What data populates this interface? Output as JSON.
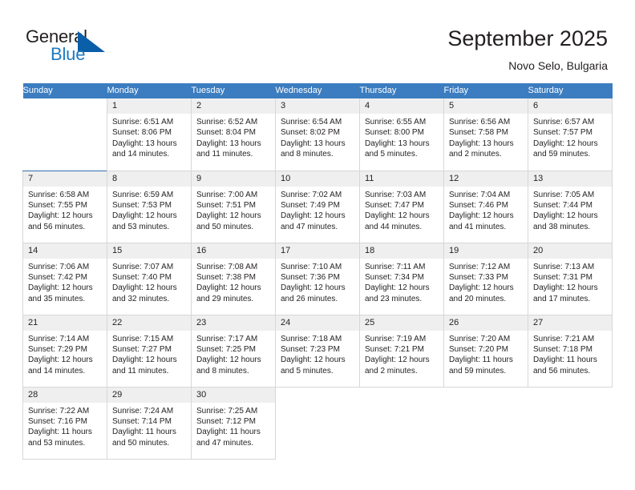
{
  "brand": {
    "word1": "General",
    "word2": "Blue",
    "icon": "triangle-logo",
    "color_dark": "#231f20",
    "color_blue": "#1f7ac0"
  },
  "header": {
    "title": "September 2025",
    "location": "Novo Selo, Bulgaria"
  },
  "theme": {
    "header_blue": "#3b7dc0",
    "week_divider": "#2f6fad",
    "cell_header_gray": "#efefef",
    "cell_border": "#d7d7d7"
  },
  "weekdays": [
    "Sunday",
    "Monday",
    "Tuesday",
    "Wednesday",
    "Thursday",
    "Friday",
    "Saturday"
  ],
  "weeks": [
    [
      {
        "empty": true
      },
      {
        "day": "1",
        "sunrise": "Sunrise: 6:51 AM",
        "sunset": "Sunset: 8:06 PM",
        "daylight1": "Daylight: 13 hours",
        "daylight2": "and 14 minutes."
      },
      {
        "day": "2",
        "sunrise": "Sunrise: 6:52 AM",
        "sunset": "Sunset: 8:04 PM",
        "daylight1": "Daylight: 13 hours",
        "daylight2": "and 11 minutes."
      },
      {
        "day": "3",
        "sunrise": "Sunrise: 6:54 AM",
        "sunset": "Sunset: 8:02 PM",
        "daylight1": "Daylight: 13 hours",
        "daylight2": "and 8 minutes."
      },
      {
        "day": "4",
        "sunrise": "Sunrise: 6:55 AM",
        "sunset": "Sunset: 8:00 PM",
        "daylight1": "Daylight: 13 hours",
        "daylight2": "and 5 minutes."
      },
      {
        "day": "5",
        "sunrise": "Sunrise: 6:56 AM",
        "sunset": "Sunset: 7:58 PM",
        "daylight1": "Daylight: 13 hours",
        "daylight2": "and 2 minutes."
      },
      {
        "day": "6",
        "sunrise": "Sunrise: 6:57 AM",
        "sunset": "Sunset: 7:57 PM",
        "daylight1": "Daylight: 12 hours",
        "daylight2": "and 59 minutes."
      }
    ],
    [
      {
        "day": "7",
        "sunrise": "Sunrise: 6:58 AM",
        "sunset": "Sunset: 7:55 PM",
        "daylight1": "Daylight: 12 hours",
        "daylight2": "and 56 minutes."
      },
      {
        "day": "8",
        "sunrise": "Sunrise: 6:59 AM",
        "sunset": "Sunset: 7:53 PM",
        "daylight1": "Daylight: 12 hours",
        "daylight2": "and 53 minutes."
      },
      {
        "day": "9",
        "sunrise": "Sunrise: 7:00 AM",
        "sunset": "Sunset: 7:51 PM",
        "daylight1": "Daylight: 12 hours",
        "daylight2": "and 50 minutes."
      },
      {
        "day": "10",
        "sunrise": "Sunrise: 7:02 AM",
        "sunset": "Sunset: 7:49 PM",
        "daylight1": "Daylight: 12 hours",
        "daylight2": "and 47 minutes."
      },
      {
        "day": "11",
        "sunrise": "Sunrise: 7:03 AM",
        "sunset": "Sunset: 7:47 PM",
        "daylight1": "Daylight: 12 hours",
        "daylight2": "and 44 minutes."
      },
      {
        "day": "12",
        "sunrise": "Sunrise: 7:04 AM",
        "sunset": "Sunset: 7:46 PM",
        "daylight1": "Daylight: 12 hours",
        "daylight2": "and 41 minutes."
      },
      {
        "day": "13",
        "sunrise": "Sunrise: 7:05 AM",
        "sunset": "Sunset: 7:44 PM",
        "daylight1": "Daylight: 12 hours",
        "daylight2": "and 38 minutes."
      }
    ],
    [
      {
        "day": "14",
        "sunrise": "Sunrise: 7:06 AM",
        "sunset": "Sunset: 7:42 PM",
        "daylight1": "Daylight: 12 hours",
        "daylight2": "and 35 minutes."
      },
      {
        "day": "15",
        "sunrise": "Sunrise: 7:07 AM",
        "sunset": "Sunset: 7:40 PM",
        "daylight1": "Daylight: 12 hours",
        "daylight2": "and 32 minutes."
      },
      {
        "day": "16",
        "sunrise": "Sunrise: 7:08 AM",
        "sunset": "Sunset: 7:38 PM",
        "daylight1": "Daylight: 12 hours",
        "daylight2": "and 29 minutes."
      },
      {
        "day": "17",
        "sunrise": "Sunrise: 7:10 AM",
        "sunset": "Sunset: 7:36 PM",
        "daylight1": "Daylight: 12 hours",
        "daylight2": "and 26 minutes."
      },
      {
        "day": "18",
        "sunrise": "Sunrise: 7:11 AM",
        "sunset": "Sunset: 7:34 PM",
        "daylight1": "Daylight: 12 hours",
        "daylight2": "and 23 minutes."
      },
      {
        "day": "19",
        "sunrise": "Sunrise: 7:12 AM",
        "sunset": "Sunset: 7:33 PM",
        "daylight1": "Daylight: 12 hours",
        "daylight2": "and 20 minutes."
      },
      {
        "day": "20",
        "sunrise": "Sunrise: 7:13 AM",
        "sunset": "Sunset: 7:31 PM",
        "daylight1": "Daylight: 12 hours",
        "daylight2": "and 17 minutes."
      }
    ],
    [
      {
        "day": "21",
        "sunrise": "Sunrise: 7:14 AM",
        "sunset": "Sunset: 7:29 PM",
        "daylight1": "Daylight: 12 hours",
        "daylight2": "and 14 minutes."
      },
      {
        "day": "22",
        "sunrise": "Sunrise: 7:15 AM",
        "sunset": "Sunset: 7:27 PM",
        "daylight1": "Daylight: 12 hours",
        "daylight2": "and 11 minutes."
      },
      {
        "day": "23",
        "sunrise": "Sunrise: 7:17 AM",
        "sunset": "Sunset: 7:25 PM",
        "daylight1": "Daylight: 12 hours",
        "daylight2": "and 8 minutes."
      },
      {
        "day": "24",
        "sunrise": "Sunrise: 7:18 AM",
        "sunset": "Sunset: 7:23 PM",
        "daylight1": "Daylight: 12 hours",
        "daylight2": "and 5 minutes."
      },
      {
        "day": "25",
        "sunrise": "Sunrise: 7:19 AM",
        "sunset": "Sunset: 7:21 PM",
        "daylight1": "Daylight: 12 hours",
        "daylight2": "and 2 minutes."
      },
      {
        "day": "26",
        "sunrise": "Sunrise: 7:20 AM",
        "sunset": "Sunset: 7:20 PM",
        "daylight1": "Daylight: 11 hours",
        "daylight2": "and 59 minutes."
      },
      {
        "day": "27",
        "sunrise": "Sunrise: 7:21 AM",
        "sunset": "Sunset: 7:18 PM",
        "daylight1": "Daylight: 11 hours",
        "daylight2": "and 56 minutes."
      }
    ],
    [
      {
        "day": "28",
        "sunrise": "Sunrise: 7:22 AM",
        "sunset": "Sunset: 7:16 PM",
        "daylight1": "Daylight: 11 hours",
        "daylight2": "and 53 minutes."
      },
      {
        "day": "29",
        "sunrise": "Sunrise: 7:24 AM",
        "sunset": "Sunset: 7:14 PM",
        "daylight1": "Daylight: 11 hours",
        "daylight2": "and 50 minutes."
      },
      {
        "day": "30",
        "sunrise": "Sunrise: 7:25 AM",
        "sunset": "Sunset: 7:12 PM",
        "daylight1": "Daylight: 11 hours",
        "daylight2": "and 47 minutes."
      },
      {
        "empty": true
      },
      {
        "empty": true
      },
      {
        "empty": true
      },
      {
        "empty": true
      }
    ]
  ]
}
